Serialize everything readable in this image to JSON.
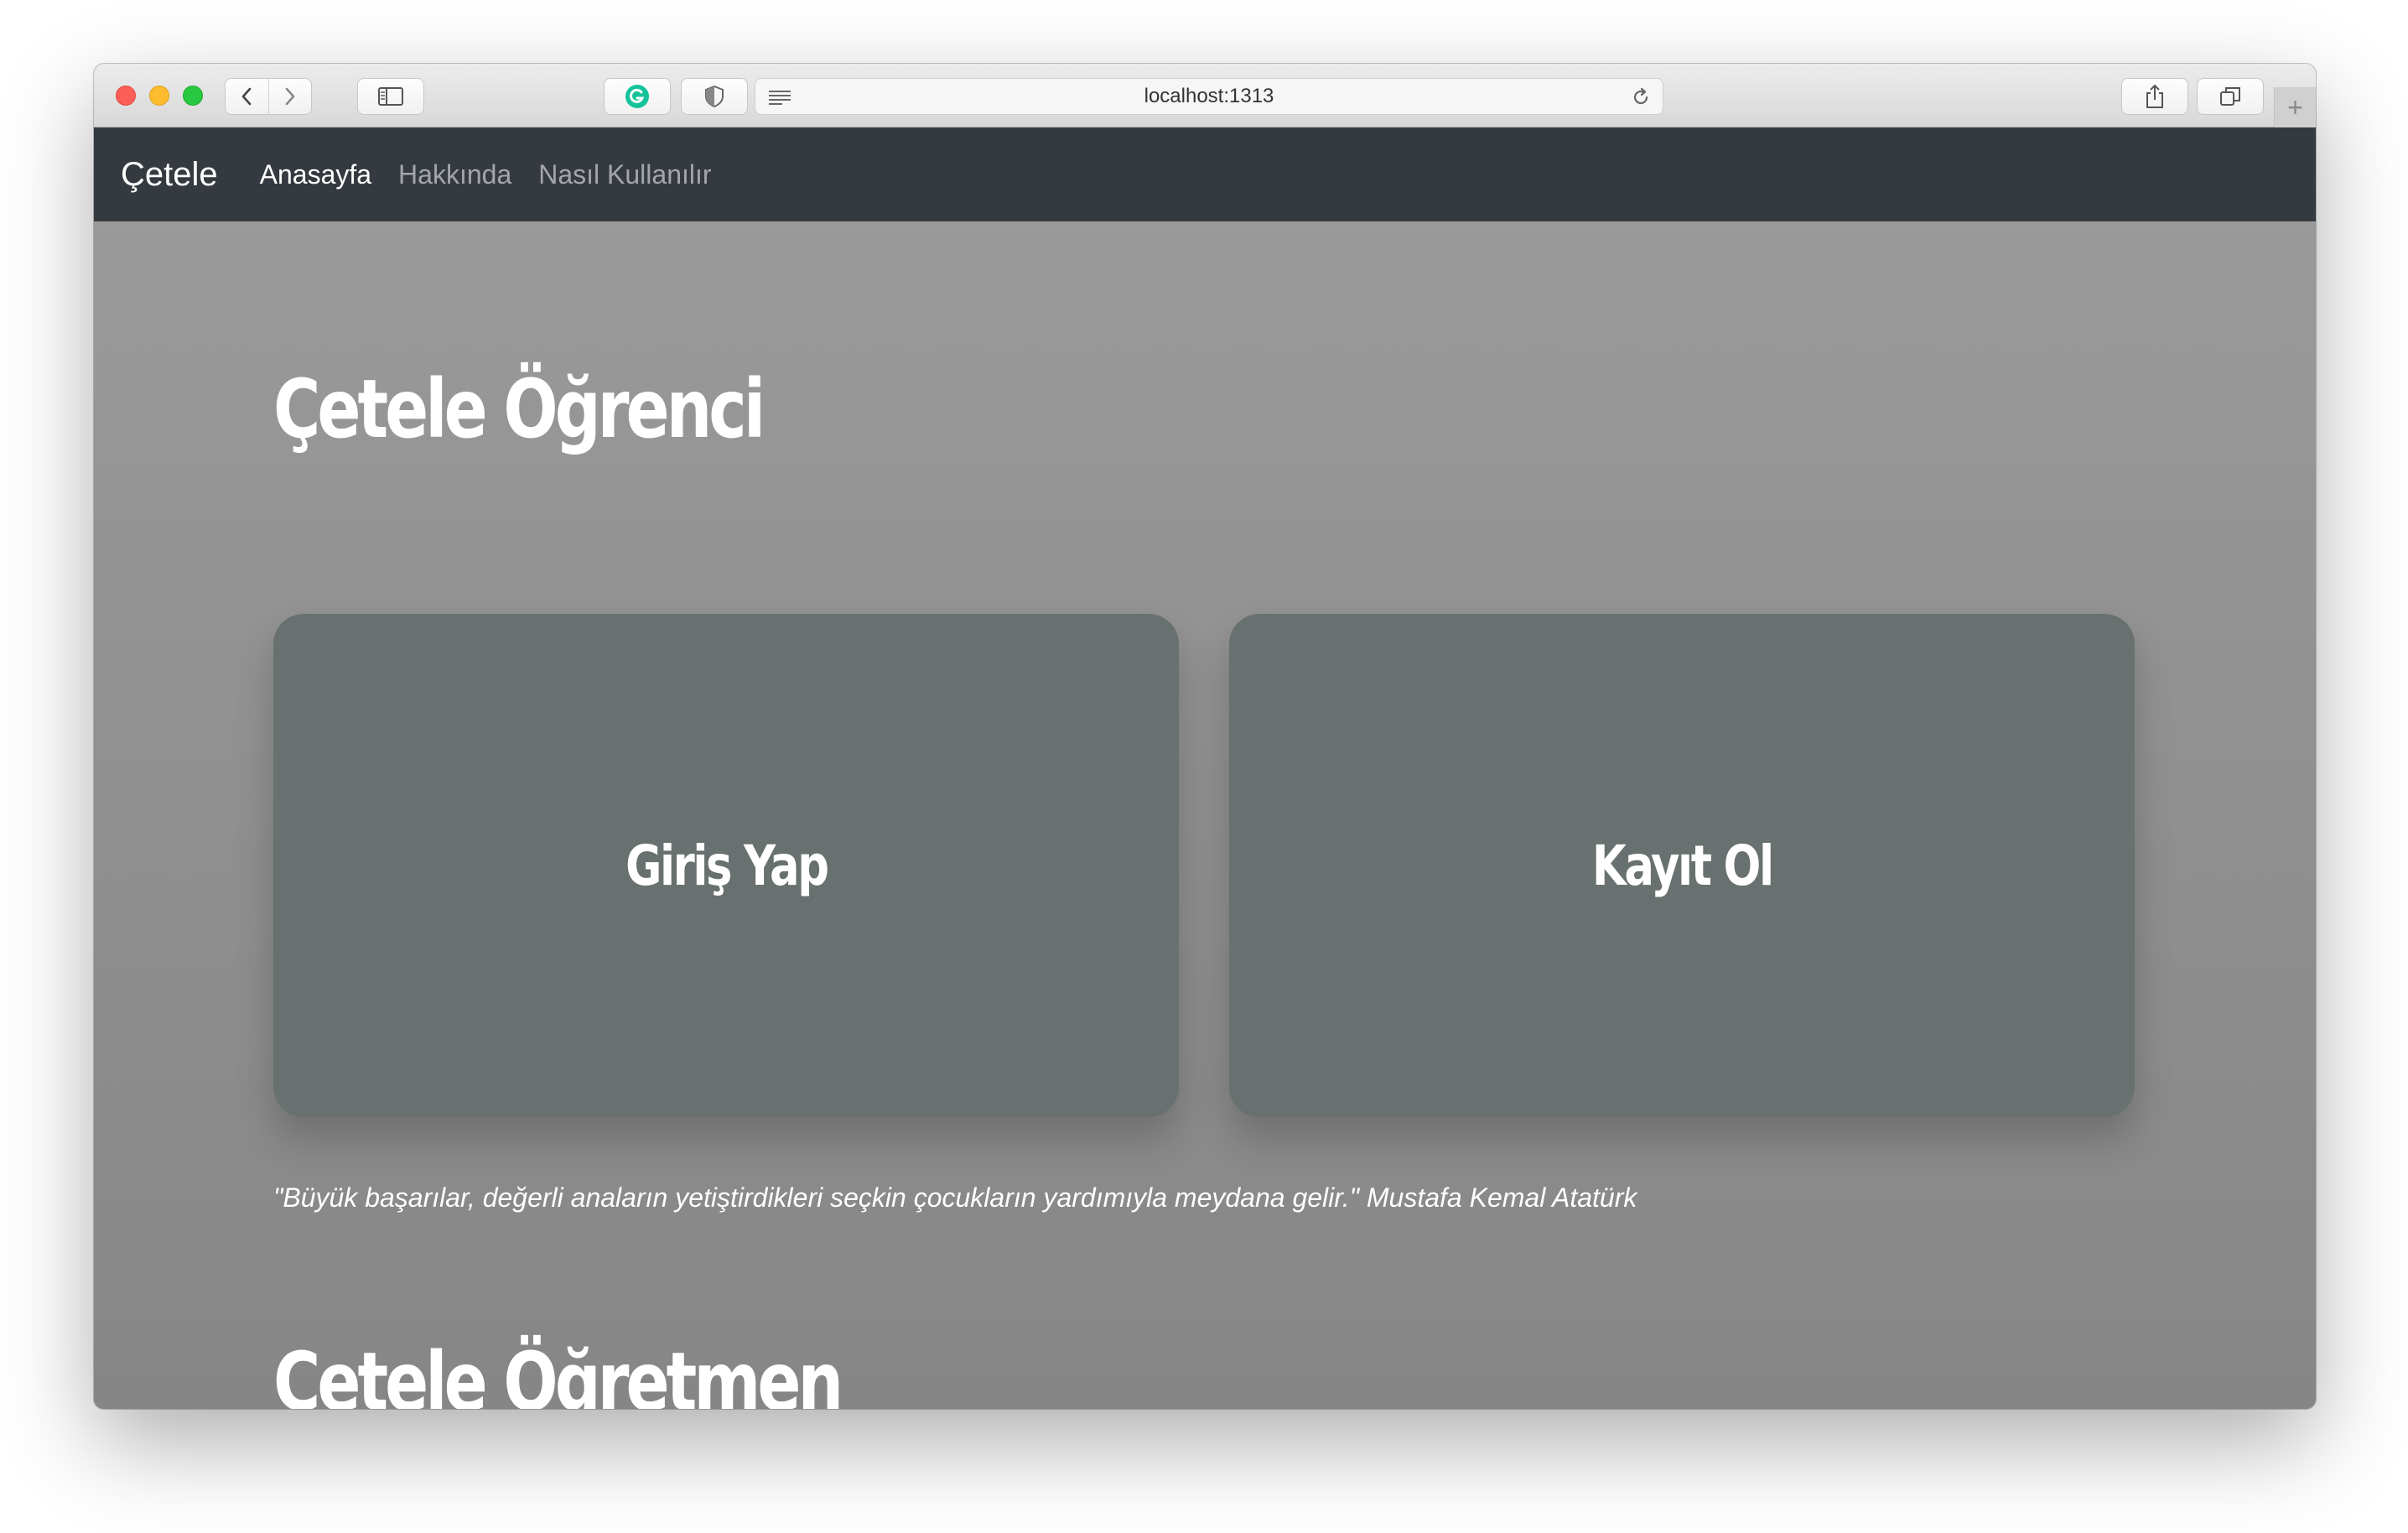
{
  "browser": {
    "url": "localhost:1313"
  },
  "navbar": {
    "brand": "Çetele",
    "links": [
      {
        "label": "Anasayfa",
        "active": true
      },
      {
        "label": "Hakkında",
        "active": false
      },
      {
        "label": "Nasıl Kullanılır",
        "active": false
      }
    ]
  },
  "student": {
    "title": "Çetele Öğrenci",
    "login_label": "Giriş Yap",
    "register_label": "Kayıt Ol"
  },
  "quote": "\"Büyük başarılar, değerli anaların yetiştirdikleri seçkin çocukların yardımıyla meydana gelir.\" Mustafa Kemal Atatürk",
  "teacher": {
    "title": "Çetele Öğretmen"
  },
  "colors": {
    "navbar_bg": "#343a40",
    "card_bg": "#687170",
    "page_bg": "#8a8a8a"
  }
}
